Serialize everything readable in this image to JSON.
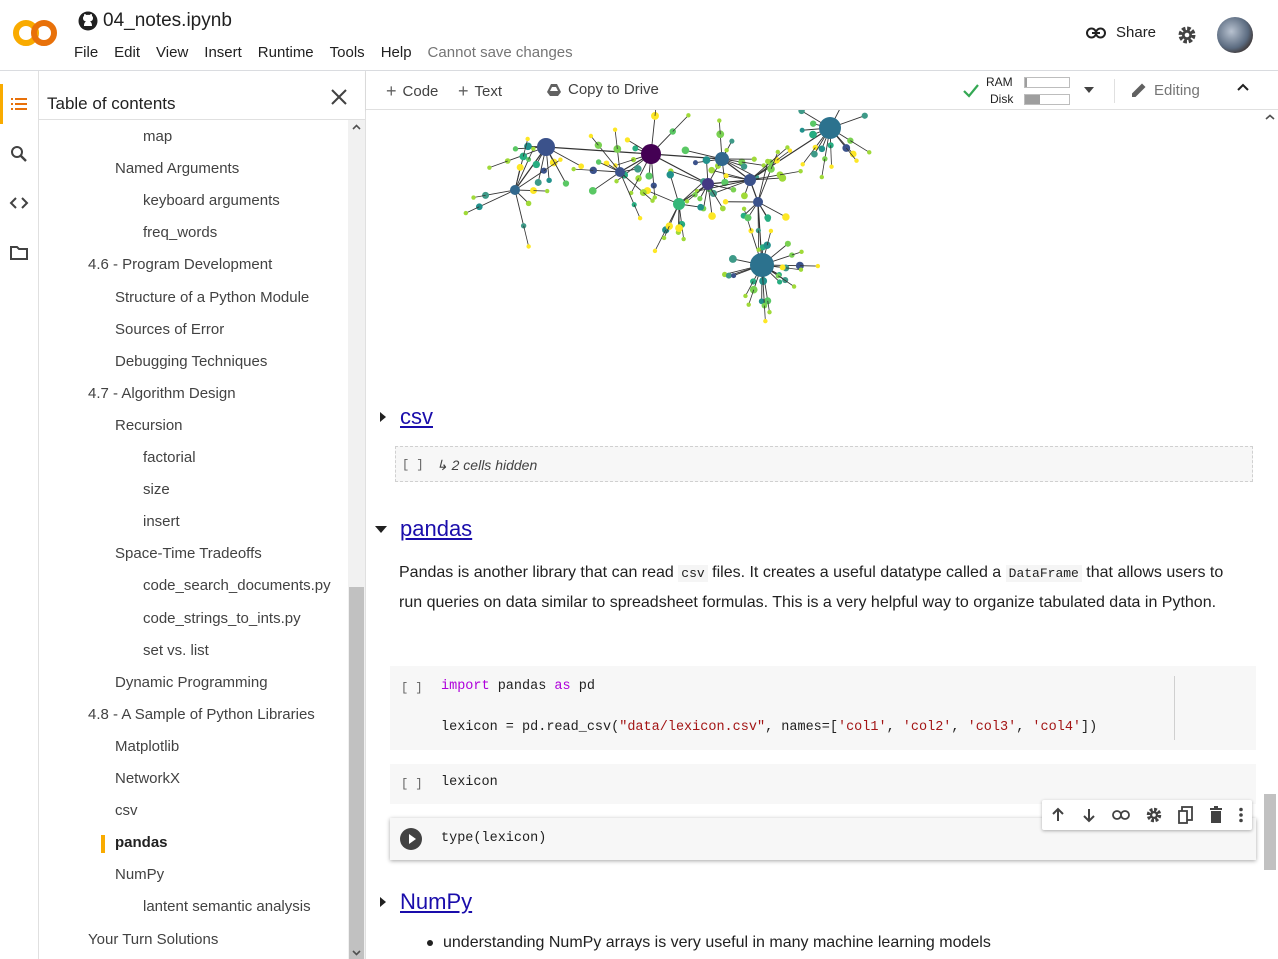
{
  "app": {
    "notebook_title": "04_notes.ipynb",
    "menu": [
      "File",
      "Edit",
      "View",
      "Insert",
      "Runtime",
      "Tools",
      "Help"
    ],
    "save_status": "Cannot save changes",
    "share_label": "Share",
    "icons": [
      "colab-logo",
      "github-icon",
      "link-icon",
      "gear-icon",
      "avatar"
    ]
  },
  "rail": {
    "icons": [
      "toc-icon",
      "search-icon",
      "code-snippets-icon",
      "files-icon"
    ],
    "accent_color": "#f9ab00"
  },
  "toc": {
    "title": "Table of contents",
    "items": [
      {
        "label": "map",
        "level": 3
      },
      {
        "label": "Named Arguments",
        "level": 2
      },
      {
        "label": "keyboard arguments",
        "level": 3
      },
      {
        "label": "freq_words",
        "level": 3
      },
      {
        "label": "4.6 - Program Development",
        "level": 1
      },
      {
        "label": "Structure of a Python Module",
        "level": 2
      },
      {
        "label": "Sources of Error",
        "level": 2
      },
      {
        "label": "Debugging Techniques",
        "level": 2
      },
      {
        "label": "4.7 - Algorithm Design",
        "level": 1
      },
      {
        "label": "Recursion",
        "level": 2
      },
      {
        "label": "factorial",
        "level": 3
      },
      {
        "label": "size",
        "level": 3
      },
      {
        "label": "insert",
        "level": 3
      },
      {
        "label": "Space-Time Tradeoffs",
        "level": 2
      },
      {
        "label": "code_search_documents.py",
        "level": 3
      },
      {
        "label": "code_strings_to_ints.py",
        "level": 3
      },
      {
        "label": "set vs. list",
        "level": 3
      },
      {
        "label": "Dynamic Programming",
        "level": 2
      },
      {
        "label": "4.8 - A Sample of Python Libraries",
        "level": 1
      },
      {
        "label": "Matplotlib",
        "level": 2
      },
      {
        "label": "NetworkX",
        "level": 2
      },
      {
        "label": "csv",
        "level": 2
      },
      {
        "label": "pandas",
        "level": 2,
        "selected": true
      },
      {
        "label": "NumPy",
        "level": 2
      },
      {
        "label": "lantent semantic analysis",
        "level": 3
      },
      {
        "label": "Your Turn Solutions",
        "level": 1
      }
    ]
  },
  "toolbar": {
    "code_label": "Code",
    "text_label": "Text",
    "copy_label": "Copy to Drive",
    "ram_label": "RAM",
    "disk_label": "Disk",
    "ram_usage": 0.05,
    "disk_usage": 0.35,
    "editing_label": "Editing"
  },
  "notebook": {
    "csv_heading": "csv",
    "hidden_bracket": "[ ]",
    "hidden_cells": "↳ 2 cells hidden",
    "pandas_heading": "pandas",
    "pandas_text": {
      "p1": "Pandas is another library that can read ",
      "c1": "csv",
      "p2": " files. It creates a useful datatype called a ",
      "c2": "DataFrame",
      "p3": " that allows users to run queries on data similar to spreadsheet formulas. This is a very helpful way to organize tabulated data in Python."
    },
    "cell1": {
      "bracket": "[ ]",
      "kw1": "import",
      "t1": " pandas ",
      "kw2": "as",
      "t2": " pd",
      "l2a": "lexicon = pd.read_csv(",
      "s1": "\"data/lexicon.csv\"",
      "l2b": ", names=[",
      "s2": "'col1'",
      "c": ", ",
      "s3": "'col2'",
      "s4": "'col3'",
      "s5": "'col4'",
      "l2c": "])"
    },
    "cell2": {
      "bracket": "[ ]",
      "code": "lexicon"
    },
    "cell3": {
      "code": "type(lexicon)"
    },
    "numpy_heading": "NumPy",
    "numpy_bullet": "understanding NumPy arrays is very useful in many machine learning models",
    "cell_toolbar_icons": [
      "move-up-icon",
      "move-down-icon",
      "link-icon",
      "gear-icon",
      "mirror-cell-icon",
      "delete-icon",
      "more-icon"
    ]
  }
}
